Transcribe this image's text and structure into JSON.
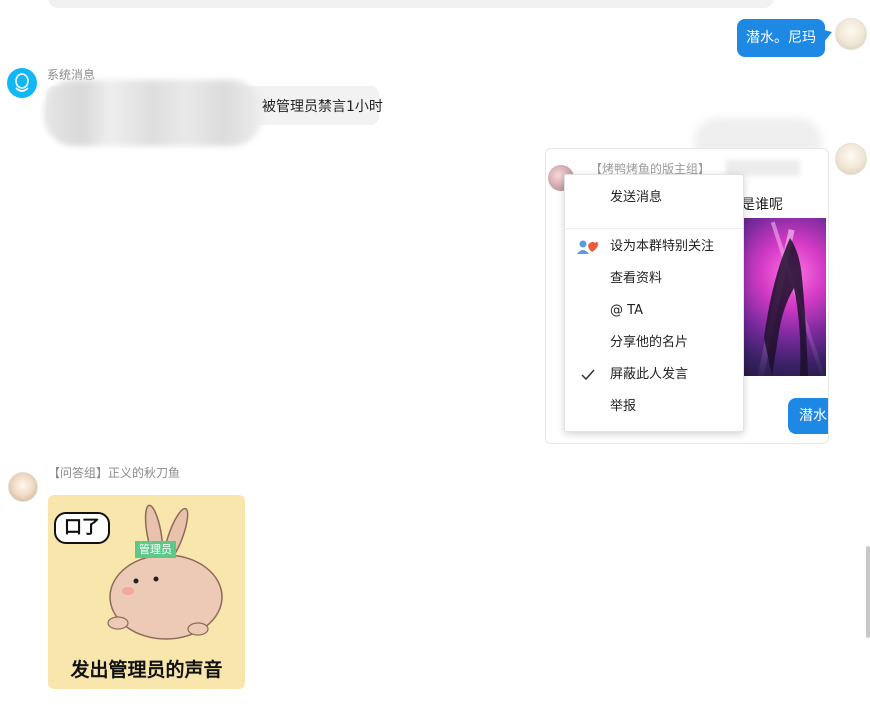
{
  "top_message": {
    "text": "潜水。尼玛"
  },
  "system_message": {
    "sender": "系统消息",
    "text": "被管理员禁言1小时"
  },
  "card_message": {
    "quote_label": "【烤鸭烤鱼的版主组】",
    "text": "是谁呢",
    "reply_text": "潜水"
  },
  "context_menu": {
    "items": [
      {
        "label": "发送消息",
        "icon": ""
      },
      {
        "label": "设为本群特别关注",
        "icon": "special-follow-icon"
      },
      {
        "label": "查看资料",
        "icon": ""
      },
      {
        "label": "@ TA",
        "icon": ""
      },
      {
        "label": "分享他的名片",
        "icon": ""
      },
      {
        "label": "屏蔽此人发言",
        "icon": "check-icon",
        "checked": true
      },
      {
        "label": "举报",
        "icon": ""
      }
    ]
  },
  "qa_message": {
    "sender": "【问答组】正义的秋刀鱼",
    "sticker": {
      "speech_text": "口了",
      "badge_text": "管理员",
      "caption": "发出管理员的声音"
    }
  },
  "colors": {
    "accent_blue": "#1e88e5",
    "system_avatar": "#12b7f5",
    "sticker_bg": "#f8e6ad",
    "badge_green": "#5cc98b"
  }
}
